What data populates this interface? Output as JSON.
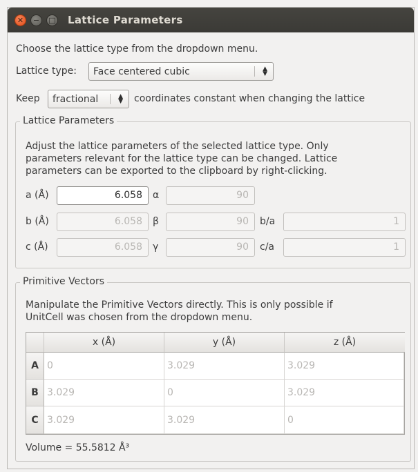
{
  "window": {
    "title": "Lattice Parameters"
  },
  "intro": "Choose the lattice type from the dropdown menu.",
  "lattice_type": {
    "label": "Lattice type:",
    "value": "Face centered cubic"
  },
  "keep": {
    "label": "Keep",
    "value": "fractional",
    "suffix": "coordinates constant when changing the lattice"
  },
  "lattice_params": {
    "legend": "Lattice Parameters",
    "desc": [
      "Adjust the lattice parameters of the selected lattice type. Only",
      "parameters relevant for the lattice type can be changed. Lattice",
      "parameters can be exported to the clipboard by right-clicking."
    ],
    "a_label": "a (Å)",
    "a_value": "6.058",
    "b_label": "b (Å)",
    "b_value": "6.058",
    "c_label": "c (Å)",
    "c_value": "6.058",
    "alpha_label": "α",
    "alpha_value": "90",
    "beta_label": "β",
    "beta_value": "90",
    "gamma_label": "γ",
    "gamma_value": "90",
    "ba_label": "b/a",
    "ba_value": "1",
    "ca_label": "c/a",
    "ca_value": "1"
  },
  "primitive": {
    "legend": "Primitive Vectors",
    "desc": [
      "Manipulate the Primitive Vectors directly. This is only possible if",
      "UnitCell was chosen from the dropdown menu."
    ],
    "columns": [
      "x (Å)",
      "y (Å)",
      "z (Å)"
    ],
    "rows": [
      {
        "label": "A",
        "cells": [
          "0",
          "3.029",
          "3.029"
        ]
      },
      {
        "label": "B",
        "cells": [
          "3.029",
          "0",
          "3.029"
        ]
      },
      {
        "label": "C",
        "cells": [
          "3.029",
          "3.029",
          "0"
        ]
      }
    ],
    "volume": "Volume = 55.5812 Å³"
  }
}
